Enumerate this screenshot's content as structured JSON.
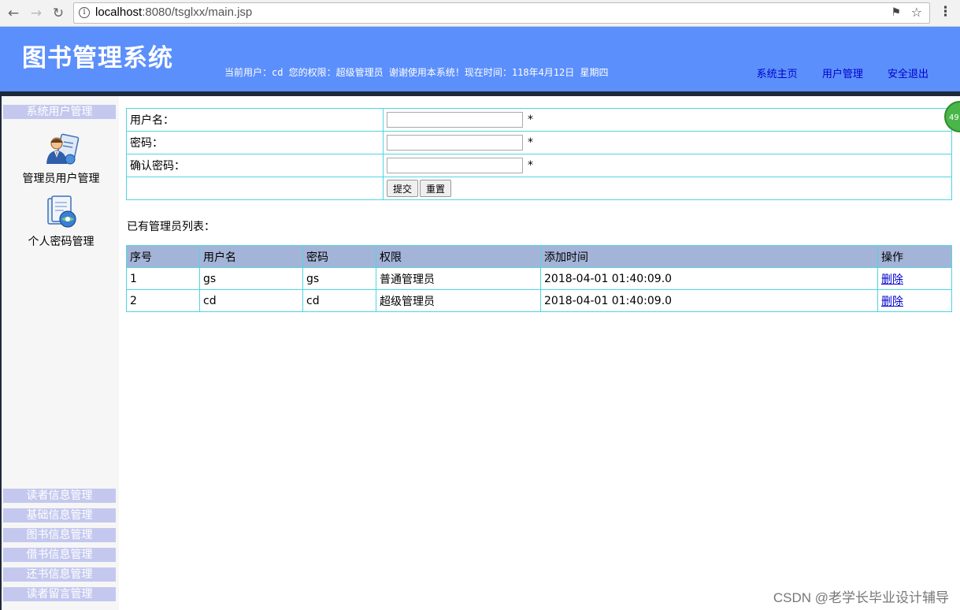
{
  "browser": {
    "url_host": "localhost",
    "url_path": ":8080/tsglxx/main.jsp"
  },
  "header": {
    "title": "图书管理系统",
    "user_info": "当前用户：cd 您的权限：超级管理员 谢谢使用本系统！现在时间：118年4月12日 星期四",
    "links": [
      "系统主页",
      "用户管理",
      "安全退出"
    ]
  },
  "sidebar": {
    "top_header": "系统用户管理",
    "items": [
      {
        "label": "管理员用户管理",
        "icon": "admin-user-icon"
      },
      {
        "label": "个人密码管理",
        "icon": "password-icon"
      }
    ],
    "bottom_headers": [
      "读者信息管理",
      "基础信息管理",
      "图书信息管理",
      "借书信息管理",
      "还书信息管理",
      "读者留言管理"
    ]
  },
  "form": {
    "username_label": "用户名：",
    "password_label": "密码：",
    "confirm_label": "确认密码：",
    "required_mark": "*",
    "username_value": "",
    "password_value": "",
    "confirm_value": "",
    "submit_label": "提交",
    "reset_label": "重置"
  },
  "list": {
    "title": "已有管理员列表：",
    "columns": [
      "序号",
      "用户名",
      "密码",
      "权限",
      "添加时间",
      "操作"
    ],
    "rows": [
      [
        "1",
        "gs",
        "gs",
        "普通管理员",
        "2018-04-01 01:40:09.0",
        "删除"
      ],
      [
        "2",
        "cd",
        "cd",
        "超级管理员",
        "2018-04-01 01:40:09.0",
        "删除"
      ]
    ]
  },
  "badge": {
    "text": "49"
  },
  "watermark": "CSDN @老学长毕业设计辅导"
}
